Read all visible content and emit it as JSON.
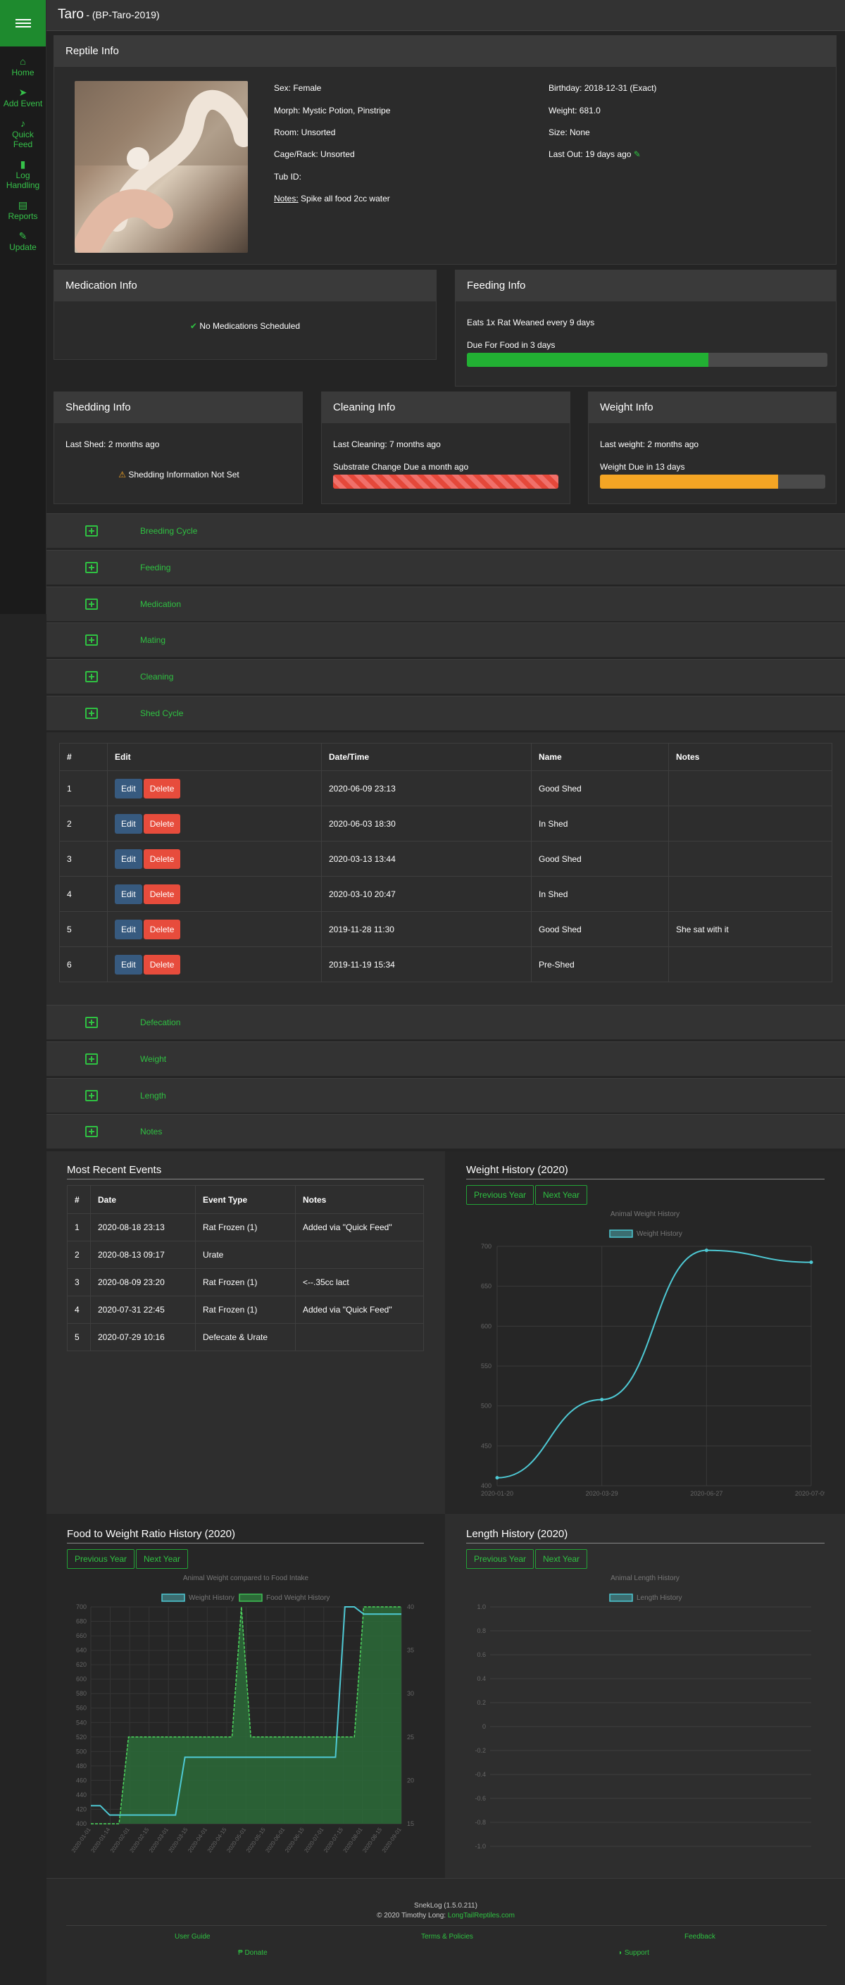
{
  "nav": {
    "items": [
      {
        "label": "Home",
        "icon": "home-icon",
        "glyph": "⌂"
      },
      {
        "label": "Add Event",
        "icon": "send-icon",
        "glyph": "➤"
      },
      {
        "label": "Quick Feed",
        "icon": "drumstick-icon",
        "glyph": "♪"
      },
      {
        "label": "Log Handling",
        "icon": "book-icon",
        "glyph": "▮"
      },
      {
        "label": "Reports",
        "icon": "print-icon",
        "glyph": "▤"
      },
      {
        "label": "Update",
        "icon": "edit-icon",
        "glyph": "✎"
      }
    ]
  },
  "header": {
    "name": "Taro",
    "tag": "- (BP-Taro-2019)"
  },
  "reptile": {
    "title": "Reptile Info",
    "sex": "Sex: Female",
    "morph": "Morph: Mystic Potion, Pinstripe",
    "room": "Room: Unsorted",
    "cage": "Cage/Rack: Unsorted",
    "tub": "Tub ID:",
    "notes_label": "Notes:",
    "notes_value": " Spike all food 2cc water",
    "birthday": "Birthday: 2018-12-31 (Exact)",
    "weight": "Weight: 681.0",
    "size": "Size: None",
    "last_out": "Last Out: 19 days ago"
  },
  "medication": {
    "title": "Medication Info",
    "status": "No Medications Scheduled"
  },
  "feeding": {
    "title": "Feeding Info",
    "line1": "Eats 1x Rat Weaned every 9 days",
    "line2": "Due For Food in 3 days",
    "progress": 0.67
  },
  "shedding": {
    "title": "Shedding Info",
    "last": "Last Shed: 2 months ago",
    "status": "Shedding Information Not Set"
  },
  "cleaning": {
    "title": "Cleaning Info",
    "last": "Last Cleaning: 7 months ago",
    "due": "Substrate Change Due a month ago",
    "progress": 1.0
  },
  "weight_info": {
    "title": "Weight Info",
    "last": "Last weight: 2 months ago",
    "due": "Weight Due in 13 days",
    "progress": 0.79
  },
  "accordion_top": [
    "Breeding Cycle",
    "Feeding",
    "Medication",
    "Mating",
    "Cleaning",
    "Shed Cycle"
  ],
  "shed_table": {
    "headers": [
      "#",
      "Edit",
      "Date/Time",
      "Name",
      "Notes"
    ],
    "edit_label": "Edit",
    "delete_label": "Delete",
    "rows": [
      {
        "n": "1",
        "date": "2020-06-09 23:13",
        "name": "Good Shed",
        "notes": ""
      },
      {
        "n": "2",
        "date": "2020-06-03 18:30",
        "name": "In Shed",
        "notes": ""
      },
      {
        "n": "3",
        "date": "2020-03-13 13:44",
        "name": "Good Shed",
        "notes": ""
      },
      {
        "n": "4",
        "date": "2020-03-10 20:47",
        "name": "In Shed",
        "notes": ""
      },
      {
        "n": "5",
        "date": "2019-11-28 11:30",
        "name": "Good Shed",
        "notes": "She sat with it"
      },
      {
        "n": "6",
        "date": "2019-11-19 15:34",
        "name": "Pre-Shed",
        "notes": ""
      }
    ]
  },
  "accordion_bottom": [
    "Defecation",
    "Weight",
    "Length",
    "Notes"
  ],
  "recent": {
    "title": "Most Recent Events",
    "headers": [
      "#",
      "Date",
      "Event Type",
      "Notes"
    ],
    "rows": [
      {
        "n": "1",
        "date": "2020-08-18 23:13",
        "type": "Rat Frozen (1)",
        "notes": "Added via \"Quick Feed\""
      },
      {
        "n": "2",
        "date": "2020-08-13 09:17",
        "type": "Urate",
        "notes": ""
      },
      {
        "n": "3",
        "date": "2020-08-09 23:20",
        "type": "Rat Frozen (1)",
        "notes": "<--.35cc lact"
      },
      {
        "n": "4",
        "date": "2020-07-31 22:45",
        "type": "Rat Frozen (1)",
        "notes": "Added via \"Quick Feed\""
      },
      {
        "n": "5",
        "date": "2020-07-29 10:16",
        "type": "Defecate & Urate",
        "notes": ""
      }
    ]
  },
  "buttons": {
    "prev": "Previous Year",
    "next": "Next Year"
  },
  "colors": {
    "accent": "#2fc142",
    "line": "#4ec9d4",
    "fill": "#2c6b38"
  },
  "chart_data": [
    {
      "type": "line",
      "section": "Weight History (2020)",
      "title": "Animal Weight History",
      "series": [
        {
          "name": "Weight History",
          "x": [
            "2020-01-20",
            "2020-03-29",
            "2020-06-07",
            "2020-07-09"
          ],
          "values": [
            410,
            508,
            695,
            680
          ]
        }
      ],
      "xticks": [
        "2020-01-20",
        "2020-03-29",
        "2020-06-27",
        "2020-07-09"
      ],
      "yticks": [
        "400",
        "450",
        "500",
        "550",
        "600",
        "650",
        "700"
      ],
      "ylim": [
        400,
        700
      ]
    },
    {
      "type": "line",
      "section": "Food to Weight Ratio History (2020)",
      "title": "Animal Weight compared to Food Intake",
      "series": [
        {
          "name": "Weight History",
          "axis": "left",
          "values": [
            425,
            425,
            412,
            412,
            412,
            412,
            412,
            412,
            412,
            412,
            492,
            492,
            492,
            492,
            492,
            492,
            492,
            492,
            492,
            492,
            492,
            492,
            492,
            492,
            492,
            492,
            492,
            700,
            700,
            690,
            690,
            690,
            690,
            690
          ]
        },
        {
          "name": "Food Weight History",
          "axis": "right",
          "values": [
            15,
            15,
            15,
            15,
            25,
            25,
            25,
            25,
            25,
            25,
            25,
            25,
            25,
            25,
            25,
            25,
            40,
            25,
            25,
            25,
            25,
            25,
            25,
            25,
            25,
            25,
            25,
            25,
            25,
            40,
            40,
            40,
            40,
            40
          ]
        }
      ],
      "yticks_left": [
        "400",
        "420",
        "440",
        "460",
        "480",
        "500",
        "520",
        "540",
        "560",
        "580",
        "600",
        "620",
        "640",
        "660",
        "680",
        "700"
      ],
      "yticks_right": [
        "15",
        "20",
        "25",
        "30",
        "35",
        "40"
      ],
      "ylim": [
        400,
        700
      ],
      "ylim_right": [
        15,
        40
      ],
      "xticks": [
        "2020-01-01",
        "2020-01-14",
        "2020-02-01",
        "2020-02-15",
        "2020-03-01",
        "2020-03-15",
        "2020-04-01",
        "2020-04-15",
        "2020-05-01",
        "2020-05-15",
        "2020-06-01",
        "2020-06-15",
        "2020-07-01",
        "2020-07-15",
        "2020-08-01",
        "2020-08-15",
        "2020-09-01"
      ]
    },
    {
      "type": "line",
      "section": "Length History (2020)",
      "title": "Animal Length History",
      "series": [
        {
          "name": "Length History",
          "values": []
        }
      ],
      "yticks": [
        "1.0",
        "0.8",
        "0.6",
        "0.4",
        "0.2",
        "0",
        "-0.2",
        "-0.4",
        "-0.6",
        "-0.8",
        "-1.0"
      ],
      "ylim": [
        -1,
        1
      ]
    }
  ],
  "footer": {
    "version": "SnekLog (1.5.0.211)",
    "copyright": "© 2020 Timothy Long: ",
    "site": "LongTailReptiles.com",
    "user_guide": "User Guide",
    "terms": "Terms & Policies",
    "feedback": "Feedback",
    "donate": "Donate",
    "support": "Support"
  }
}
